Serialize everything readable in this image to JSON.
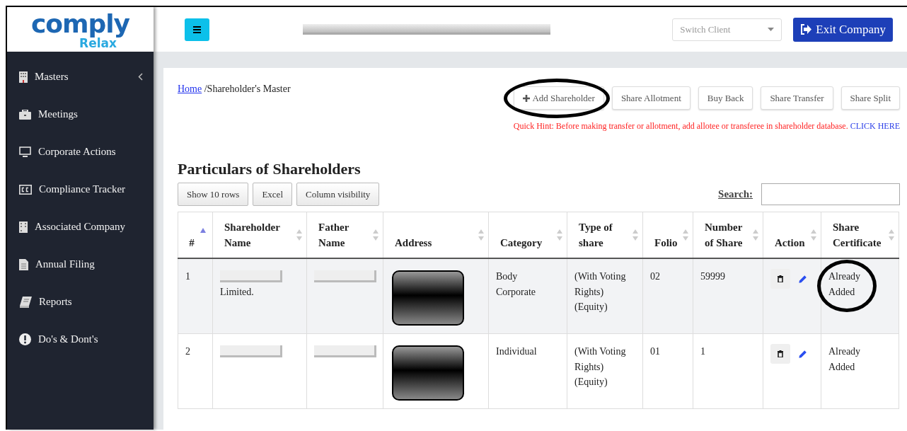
{
  "logo": {
    "word": "comply",
    "tagline": "Relax"
  },
  "sidebar": {
    "items": [
      {
        "label": "Masters",
        "expandable": true
      },
      {
        "label": "Meetings",
        "expandable": false
      },
      {
        "label": "Corporate Actions",
        "expandable": false
      },
      {
        "label": "Compliance Tracker",
        "expandable": false
      },
      {
        "label": "Associated Company",
        "expandable": false
      },
      {
        "label": "Annual Filing",
        "expandable": false
      },
      {
        "label": "Reports",
        "expandable": false
      },
      {
        "label": "Do's & Dont's",
        "expandable": false
      }
    ]
  },
  "topbar": {
    "company_redacted": true,
    "switch_client": {
      "placeholder": "Switch Client"
    },
    "exit_button": "Exit Company"
  },
  "breadcrumb": {
    "link": "Home",
    "current": "/Shareholder's Master"
  },
  "actions": [
    {
      "label": "Add Shareholder",
      "kind": "add",
      "circled": true
    },
    {
      "label": "Share Allotment",
      "kind": "plain",
      "circled": false
    },
    {
      "label": "Buy Back",
      "kind": "plain",
      "circled": false
    },
    {
      "label": "Share Transfer",
      "kind": "plain",
      "circled": false
    },
    {
      "label": "Share Split",
      "kind": "plain",
      "circled": false
    }
  ],
  "hint": {
    "text": "Quick Hint: Before making transfer or allotment, add allotee or transferee in shareholder database.",
    "link": "CLICK HERE"
  },
  "title": "Particulars of Shareholders",
  "table_buttons": [
    "Show 10 rows",
    "Excel",
    "Column visibility"
  ],
  "search": {
    "label": "Search:"
  },
  "table": {
    "columns": [
      {
        "label": "#",
        "sorted": true
      },
      {
        "label": "Shareholder Name",
        "sorted": false
      },
      {
        "label": "Father Name",
        "sorted": false
      },
      {
        "label": "Address",
        "sorted": false
      },
      {
        "label": "Category",
        "sorted": false
      },
      {
        "label": "Type of share",
        "sorted": false
      },
      {
        "label": "Folio",
        "sorted": false
      },
      {
        "label": "Number of Share",
        "sorted": false
      },
      {
        "label": "Action",
        "sorted": false
      },
      {
        "label": "Share Certificate",
        "sorted": false
      }
    ],
    "rows": [
      {
        "number": "1",
        "shareholder_name": {
          "text": "Limited.",
          "redacted": true
        },
        "father_name": {
          "redacted": true
        },
        "address": {
          "redacted": true
        },
        "category": "Body Corporate",
        "type_of_share": "(With Voting Rights) (Equity)",
        "folio": "02",
        "number_of_share": "59999",
        "certificate": "Already Added",
        "certificate_circled": true
      },
      {
        "number": "2",
        "shareholder_name": {
          "redacted": true
        },
        "father_name": {
          "redacted": true
        },
        "address": {
          "redacted": true
        },
        "category": "Individual",
        "type_of_share": "(With Voting Rights) (Equity)",
        "folio": "01",
        "number_of_share": "1",
        "certificate": "Already Added",
        "certificate_circled": false
      }
    ]
  }
}
